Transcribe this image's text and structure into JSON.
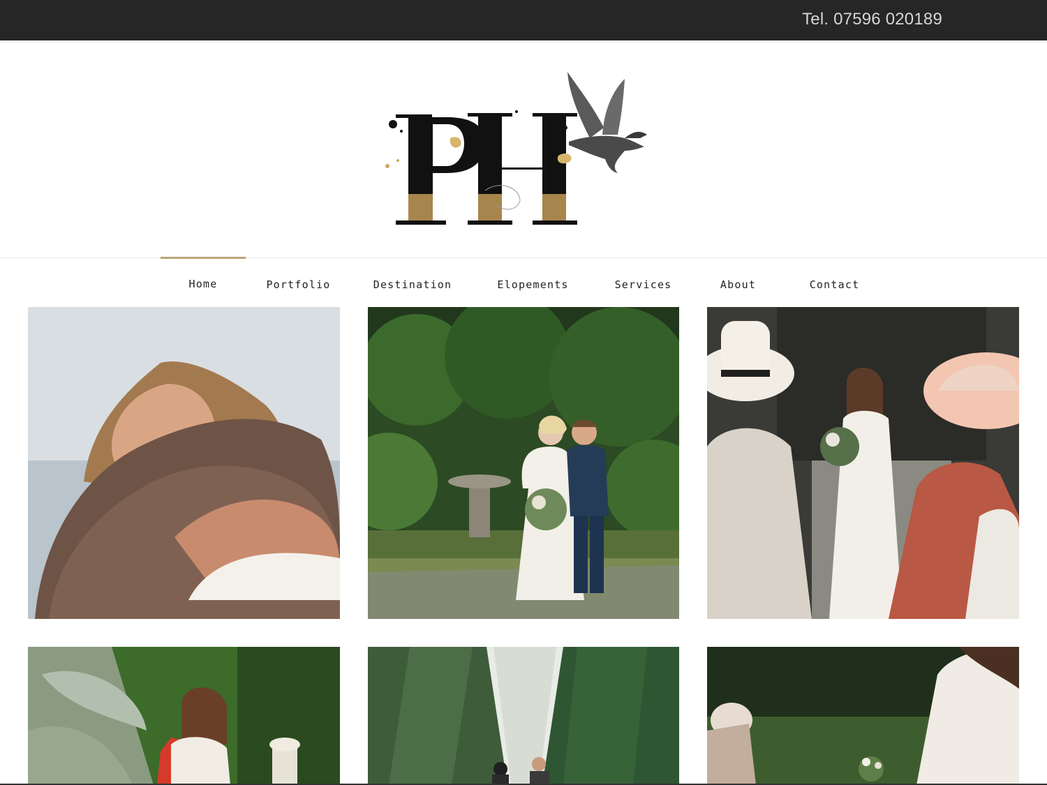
{
  "topbar": {
    "phone": "Tel. 07596 020189"
  },
  "logo": {
    "letters": "PH",
    "bird": "raven-logo-mark"
  },
  "nav": {
    "items": [
      {
        "label": "Home",
        "active": true
      },
      {
        "label": "Portfolio"
      },
      {
        "label": "Destination"
      },
      {
        "label": "Elopements"
      },
      {
        "label": "Services"
      },
      {
        "label": "About"
      },
      {
        "label": "Contact"
      }
    ],
    "accent_color": "#bfa47a"
  },
  "gallery": {
    "items": [
      {
        "subject": "embrace-photo"
      },
      {
        "subject": "bride-and-groom-garden-photo"
      },
      {
        "subject": "bride-walking-aisle-photo"
      },
      {
        "subject": "bride-garden-photo"
      },
      {
        "subject": "couple-forest-path-photo"
      },
      {
        "subject": "lace-dress-bouquet-photo"
      }
    ]
  },
  "colors": {
    "topbar": "#262626",
    "accent": "#bfa47a"
  }
}
